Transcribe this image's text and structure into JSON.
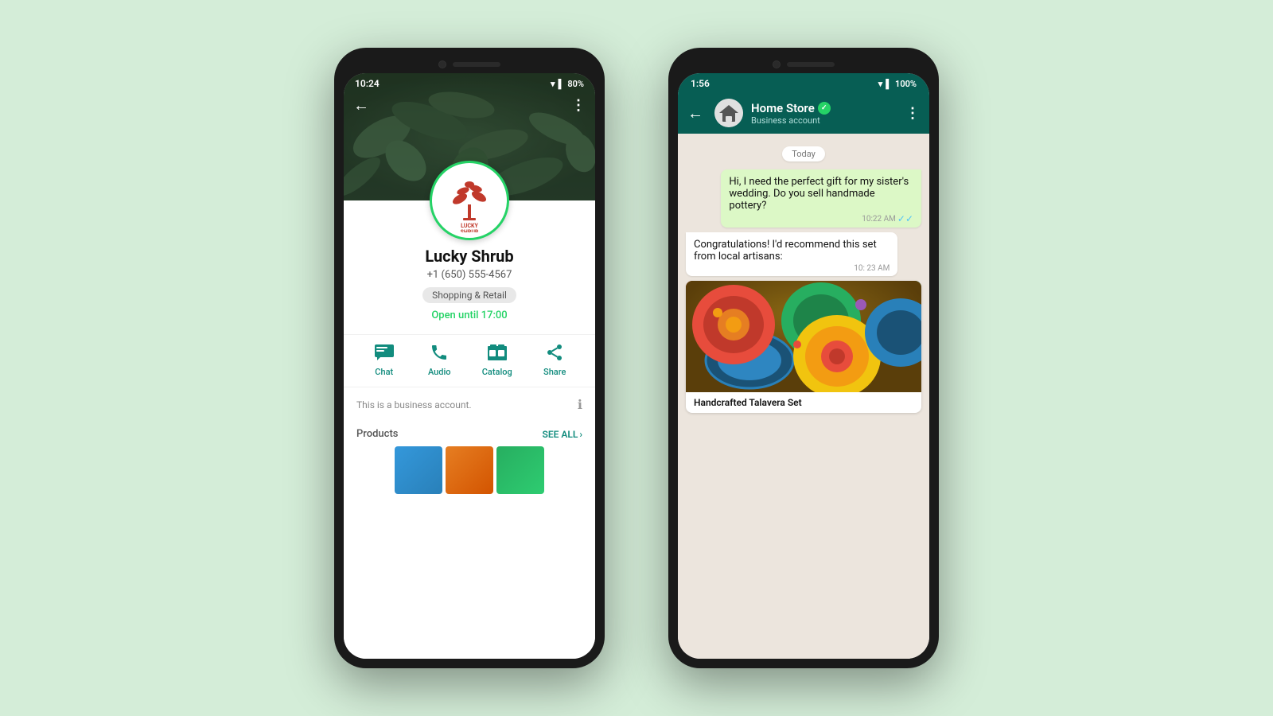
{
  "background": "#d4edd8",
  "phone1": {
    "status": {
      "time": "10:24",
      "battery": "80%"
    },
    "profile": {
      "name": "Lucky Shrub",
      "phone": "+1 (650) 555-4567",
      "category": "Shopping & Retail",
      "hours": "Open until 17:00",
      "business_note": "This is a business account.",
      "products_label": "Products",
      "see_all": "SEE ALL"
    },
    "actions": {
      "chat": "Chat",
      "audio": "Audio",
      "catalog": "Catalog",
      "share": "Share"
    }
  },
  "phone2": {
    "status": {
      "time": "1:56",
      "battery": "100%"
    },
    "header": {
      "name": "Home Store",
      "verified": true,
      "subtitle": "Business account"
    },
    "date_divider": "Today",
    "messages": [
      {
        "type": "sent",
        "text": "Hi, I need the perfect gift for my sister's wedding. Do you sell handmade pottery?",
        "time": "10:22 AM",
        "read": true
      },
      {
        "type": "received",
        "text": "Congratulations! I'd recommend this set from local artisans:",
        "time": "10: 23 AM"
      }
    ],
    "product_card": {
      "title": "Handcrafted Talavera Set"
    }
  }
}
